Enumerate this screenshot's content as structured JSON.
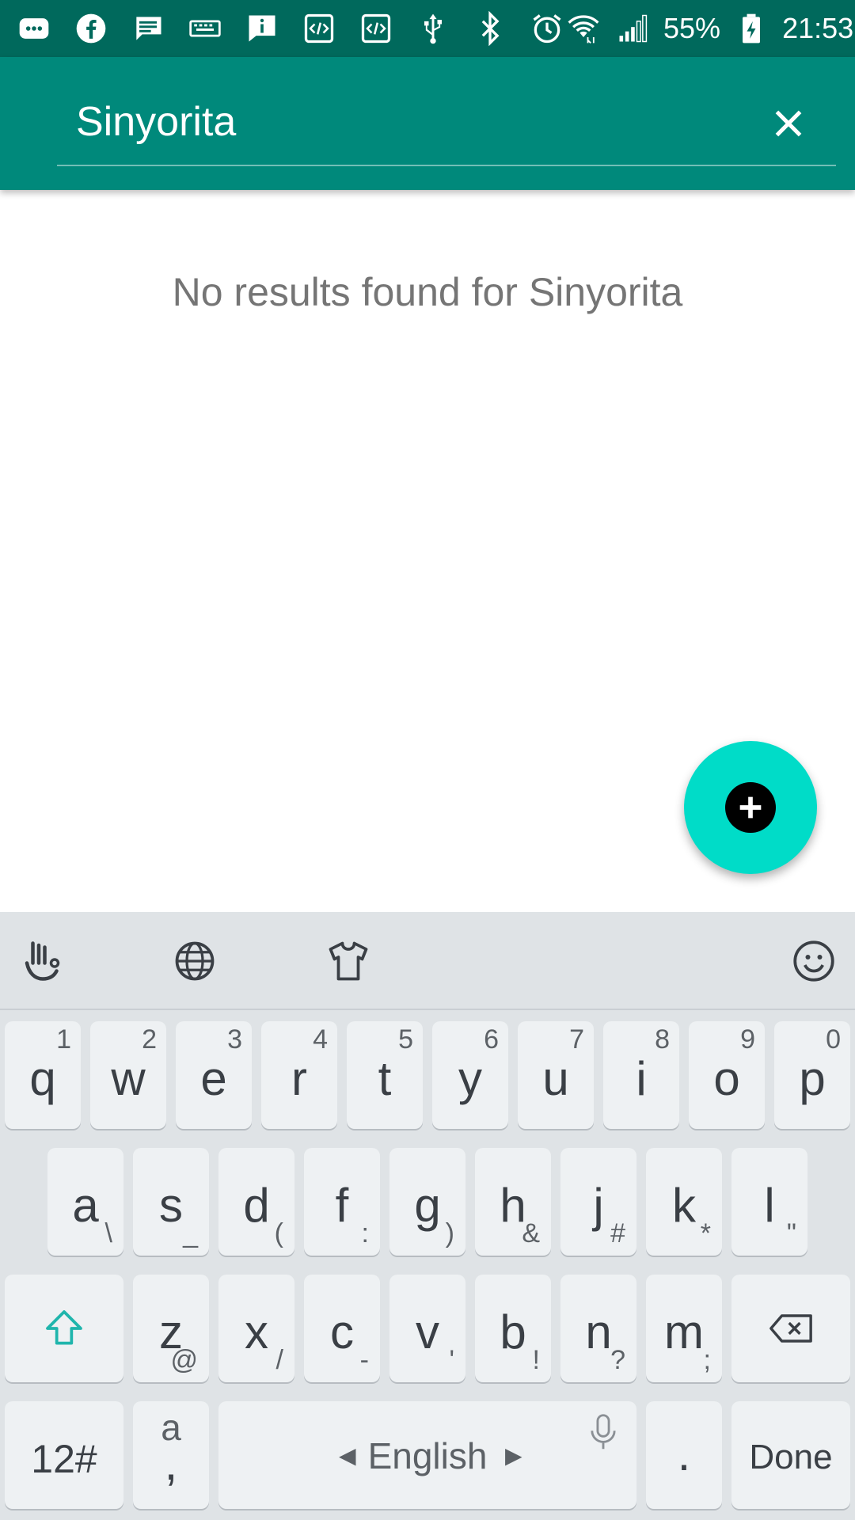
{
  "status_bar": {
    "icons": [
      "more-messages-icon",
      "facebook-icon",
      "message-icon",
      "keyboard-icon",
      "info-icon",
      "code-icon",
      "code-icon",
      "usb-icon",
      "bluetooth-icon",
      "alarm-icon",
      "wifi-icon",
      "signal-icon",
      "battery-icon"
    ],
    "battery": "55%",
    "time": "21:53"
  },
  "search": {
    "value": "Sinyorita"
  },
  "content": {
    "empty_message": "No results found for Sinyorita"
  },
  "colors": {
    "status_bar": "#00695c",
    "app_bar": "#00897b",
    "fab": "#00dcc8",
    "caret": "#e91e63"
  },
  "keyboard": {
    "toolbar": [
      "gesture-icon",
      "globe-icon",
      "theme-shirt-icon",
      "emoji-icon"
    ],
    "row1": [
      {
        "key": "q",
        "num": "1"
      },
      {
        "key": "w",
        "num": "2"
      },
      {
        "key": "e",
        "num": "3"
      },
      {
        "key": "r",
        "num": "4"
      },
      {
        "key": "t",
        "num": "5"
      },
      {
        "key": "y",
        "num": "6"
      },
      {
        "key": "u",
        "num": "7"
      },
      {
        "key": "i",
        "num": "8"
      },
      {
        "key": "o",
        "num": "9"
      },
      {
        "key": "p",
        "num": "0"
      }
    ],
    "row2": [
      {
        "key": "a",
        "sub": "\\"
      },
      {
        "key": "s",
        "sub": "_"
      },
      {
        "key": "d",
        "sub": "("
      },
      {
        "key": "f",
        "sub": ":"
      },
      {
        "key": "g",
        "sub": ")"
      },
      {
        "key": "h",
        "sub": "&"
      },
      {
        "key": "j",
        "sub": "#"
      },
      {
        "key": "k",
        "sub": "*"
      },
      {
        "key": "l",
        "sub": "\""
      }
    ],
    "row3": [
      {
        "key": "z",
        "sub": "@"
      },
      {
        "key": "x",
        "sub": "/"
      },
      {
        "key": "c",
        "sub": "-"
      },
      {
        "key": "v",
        "sub": "'"
      },
      {
        "key": "b",
        "sub": "!"
      },
      {
        "key": "n",
        "sub": "?"
      },
      {
        "key": "m",
        "sub": ";"
      }
    ],
    "symbols_label": "12#",
    "comma_key": {
      "top": "a",
      "bottom": ","
    },
    "space_label": "English",
    "period_label": ".",
    "done_label": "Done"
  }
}
